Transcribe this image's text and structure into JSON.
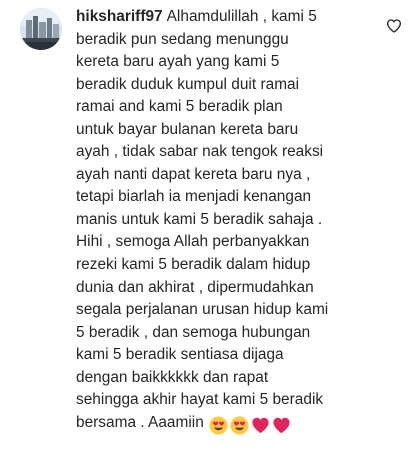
{
  "comment": {
    "username": "hikshariff97",
    "lines": [
      "Alhamdulillah , kami 5",
      "beradik pun sedang menunggu",
      "kereta baru ayah yang kami 5",
      "beradik duduk kumpul duit ramai",
      "ramai and kami 5 beradik plan",
      "untuk bayar bulanan kereta baru",
      "ayah , tidak sabar nak tengok reaksi",
      "ayah nanti dapat kereta baru nya ,",
      "tetapi biarlah ia menjadi kenangan",
      "manis untuk kami 5 beradik sahaja .",
      "Hihi , semoga Allah perbanyakkan",
      "rezeki kami 5 beradik dalam hidup",
      "dunia dan akhirat , dipermudahkan",
      "segala perjalanan urusan hidup kami",
      "5 beradik , dan semoga hubungan",
      "kami 5 beradik sentiasa dijaga",
      "dengan baikkkkkk dan rapat",
      "sehingga akhir hayat kami 5 beradik",
      "bersama . Aaamiin"
    ],
    "emojis": [
      "heart-eyes-emoji",
      "heart-eyes-emoji",
      "red-heart-emoji",
      "red-heart-emoji"
    ]
  },
  "colors": {
    "text": "#262626",
    "heart_outline": "#262626",
    "emoji_face": "#FFC83D",
    "emoji_heart": "#E0245E"
  },
  "icons": {
    "like": "heart-outline-icon"
  }
}
